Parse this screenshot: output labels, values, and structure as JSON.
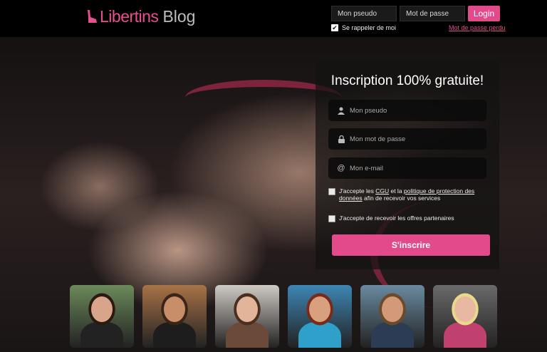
{
  "brand": {
    "name": "Libertins",
    "suffix": "Blog",
    "accent": "#e24a8c"
  },
  "login": {
    "pseudo_placeholder": "Mon pseudo",
    "password_placeholder": "Mot de passe",
    "button": "Login",
    "remember_label": "Se rappeler de moi",
    "remember_checked": true,
    "forgot_link": "Mot de passe perdu"
  },
  "signup": {
    "title": "Inscription 100% gratuite!",
    "pseudo_placeholder": "Mon pseudo",
    "password_placeholder": "Mon mot de passe",
    "email_placeholder": "Mon e-mail",
    "cgu_prefix": "J'accepte les ",
    "cgu_link": "CGU",
    "cgu_middle": " et la ",
    "privacy_link": "politique de protection des données",
    "cgu_suffix": " afin de recevoir vos services",
    "partners_label": "J'accepte de recevoir les offres partenaires",
    "submit": "S'inscrire",
    "icons": [
      "user-icon",
      "lock-icon",
      "at-icon"
    ]
  },
  "profiles": [
    {
      "name": "profile-1",
      "bg": "#6b8a5a",
      "skin": "#d9a58a",
      "hair": "#2a1a12",
      "top": "#222222"
    },
    {
      "name": "profile-2",
      "bg": "#a87346",
      "skin": "#c88e6a",
      "hair": "#3a2518",
      "top": "#1d1d1d"
    },
    {
      "name": "profile-3",
      "bg": "#cfcac4",
      "skin": "#e2b49a",
      "hair": "#4a2e1e",
      "top": "#6b4a3a"
    },
    {
      "name": "profile-4",
      "bg": "#3d86b5",
      "skin": "#d9a07e",
      "hair": "#7a2a1a",
      "top": "#2fa0c9"
    },
    {
      "name": "profile-5",
      "bg": "#6a8aa0",
      "skin": "#d29a78",
      "hair": "#6b4a2a",
      "top": "#2d3c55"
    },
    {
      "name": "profile-6",
      "bg": "#6a6a6a",
      "skin": "#e8b9a0",
      "hair": "#e9d98a",
      "top": "#c04070"
    }
  ]
}
